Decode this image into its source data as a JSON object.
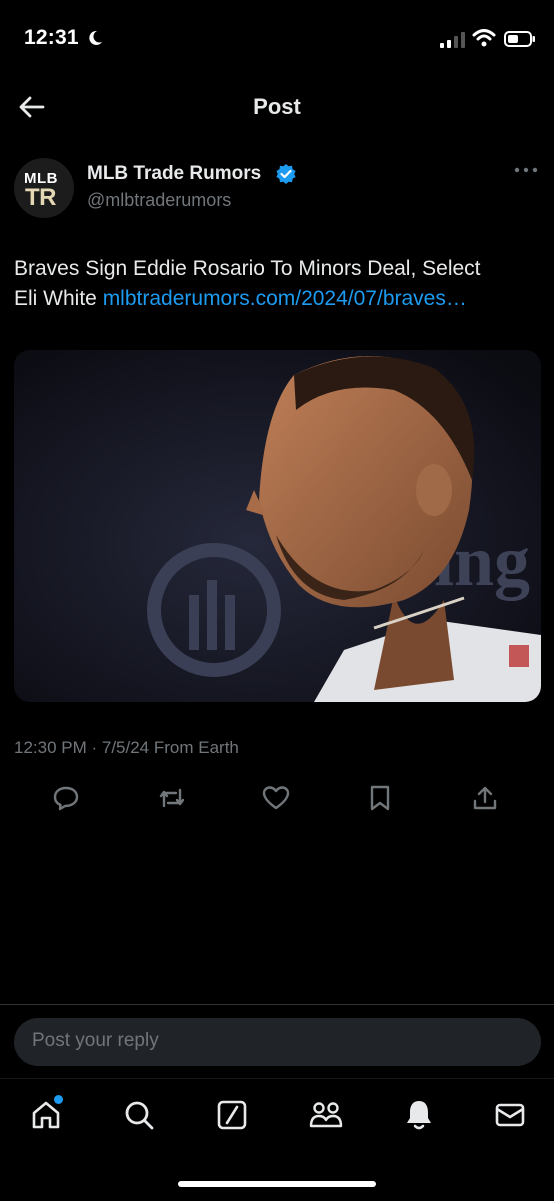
{
  "status_bar": {
    "time": "12:31"
  },
  "header": {
    "title": "Post"
  },
  "post": {
    "author": {
      "name": "MLB Trade Rumors",
      "handle": "@mlbtraderumors",
      "avatar_top": "MLB",
      "avatar_bottom": "TR"
    },
    "text_line1": "Braves Sign Eddie Rosario To Minors Deal, Select",
    "text_line2_prefix": "Eli White ",
    "link": "mlbtraderumors.com/2024/07/braves…",
    "media_background_text": "ing",
    "timestamp": "12:30 PM · 7/5/24 From Earth"
  },
  "actions": [
    "reply-icon",
    "repost-icon",
    "like-icon",
    "bookmark-icon",
    "share-icon"
  ],
  "reply": {
    "placeholder": "Post your reply"
  },
  "tabs": [
    "home-icon",
    "search-icon",
    "grok-icon",
    "communities-icon",
    "notifications-icon",
    "messages-icon"
  ],
  "colors": {
    "accent": "#1d9bf0",
    "background": "#000000",
    "muted": "#71767b"
  }
}
